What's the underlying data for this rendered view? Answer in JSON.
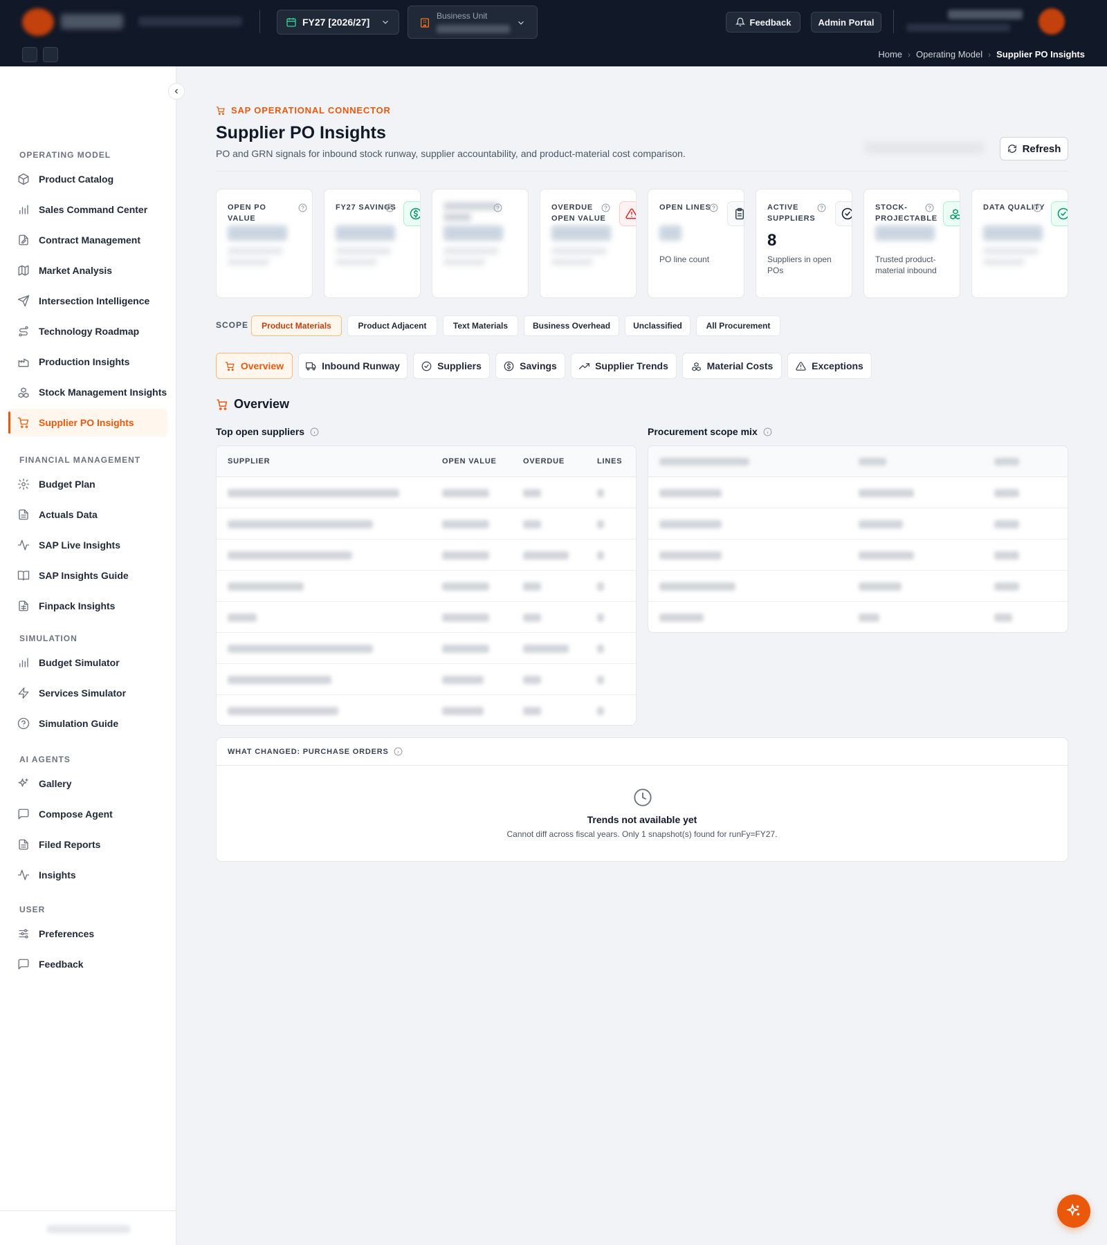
{
  "header": {
    "fiscal_year": "FY27 [2026/27]",
    "business_unit_label": "Business Unit",
    "feedback_label": "Feedback",
    "admin_label": "Admin Portal"
  },
  "breadcrumb": [
    "Home",
    "Operating Model",
    "Supplier PO Insights"
  ],
  "sidebar": {
    "sections": [
      {
        "title": "OPERATING MODEL",
        "items": [
          {
            "label": "Product Catalog",
            "icon": "package-icon"
          },
          {
            "label": "Sales Command Center",
            "icon": "bar-chart-icon"
          },
          {
            "label": "Contract Management",
            "icon": "file-edit-icon"
          },
          {
            "label": "Market Analysis",
            "icon": "map-icon"
          },
          {
            "label": "Intersection Intelligence",
            "icon": "send-icon"
          },
          {
            "label": "Technology Roadmap",
            "icon": "route-icon"
          },
          {
            "label": "Production Insights",
            "icon": "factory-icon"
          },
          {
            "label": "Stock Management Insights",
            "icon": "boxes-icon"
          },
          {
            "label": "Supplier PO Insights",
            "icon": "cart-icon",
            "active": true
          }
        ]
      },
      {
        "title": "FINANCIAL MANAGEMENT",
        "items": [
          {
            "label": "Budget Plan",
            "icon": "gear-icon"
          },
          {
            "label": "Actuals Data",
            "icon": "document-icon"
          },
          {
            "label": "SAP Live Insights",
            "icon": "activity-icon"
          },
          {
            "label": "SAP Insights Guide",
            "icon": "book-icon"
          },
          {
            "label": "Finpack Insights",
            "icon": "file-spreadsheet-icon"
          }
        ]
      },
      {
        "title": "SIMULATION",
        "items": [
          {
            "label": "Budget Simulator",
            "icon": "bar-chart-icon"
          },
          {
            "label": "Services Simulator",
            "icon": "zap-icon"
          },
          {
            "label": "Simulation Guide",
            "icon": "help-circle-icon"
          }
        ]
      },
      {
        "title": "AI AGENTS",
        "items": [
          {
            "label": "Gallery",
            "icon": "sparkles-icon"
          },
          {
            "label": "Compose Agent",
            "icon": "message-icon"
          },
          {
            "label": "Filed Reports",
            "icon": "document-icon"
          },
          {
            "label": "Insights",
            "icon": "activity-icon"
          }
        ]
      },
      {
        "title": "USER",
        "items": [
          {
            "label": "Preferences",
            "icon": "sliders-icon"
          },
          {
            "label": "Feedback",
            "icon": "message-icon"
          }
        ]
      }
    ]
  },
  "page": {
    "eyebrow": "SAP OPERATIONAL CONNECTOR",
    "title": "Supplier PO Insights",
    "description": "PO and GRN signals for inbound stock runway, supplier accountability, and product-material cost comparison.",
    "refresh_label": "Refresh"
  },
  "kpis": [
    {
      "label": "OPEN PO VALUE",
      "value": "",
      "sub": "",
      "icon": ""
    },
    {
      "label": "FY27 SAVINGS",
      "value": "",
      "sub": "",
      "icon": "dollar-icon"
    },
    {
      "label": "",
      "value": "",
      "sub": "",
      "icon": ""
    },
    {
      "label": "OVERDUE OPEN VALUE",
      "value": "",
      "sub": "",
      "icon": "alert-icon"
    },
    {
      "label": "OPEN LINES",
      "value": "",
      "sub": "PO line count",
      "icon": "clipboard-icon"
    },
    {
      "label": "ACTIVE SUPPLIERS",
      "value": "8",
      "sub": "Suppliers in open POs",
      "icon": "check-circle-icon"
    },
    {
      "label": "STOCK-PROJECTABLE",
      "value": "",
      "sub": "Trusted product-material inbound",
      "icon": "boxes-icon"
    },
    {
      "label": "DATA QUALITY",
      "value": "",
      "sub": "",
      "icon": "check-circle-icon"
    }
  ],
  "scope": {
    "label": "SCOPE",
    "chips": [
      "Product Materials",
      "Product Adjacent",
      "Text Materials",
      "Business Overhead",
      "Unclassified",
      "All Procurement"
    ],
    "active": "Product Materials"
  },
  "tabs": [
    {
      "label": "Overview",
      "icon": "cart-icon",
      "active": true
    },
    {
      "label": "Inbound Runway",
      "icon": "truck-icon"
    },
    {
      "label": "Suppliers",
      "icon": "check-circle-icon"
    },
    {
      "label": "Savings",
      "icon": "dollar-icon"
    },
    {
      "label": "Supplier Trends",
      "icon": "trending-up-icon"
    },
    {
      "label": "Material Costs",
      "icon": "boxes-icon"
    },
    {
      "label": "Exceptions",
      "icon": "alert-icon"
    }
  ],
  "overview": {
    "title": "Overview",
    "suppliers_title": "Top open suppliers",
    "suppliers_columns": [
      "SUPPLIER",
      "OPEN VALUE",
      "OVERDUE",
      "LINES"
    ],
    "scope_mix_title": "Procurement scope mix"
  },
  "changes": {
    "title": "WHAT CHANGED: PURCHASE ORDERS",
    "empty_title": "Trends not available yet",
    "empty_desc": "Cannot diff across fiscal years. Only 1 snapshot(s) found for runFy=FY27."
  }
}
